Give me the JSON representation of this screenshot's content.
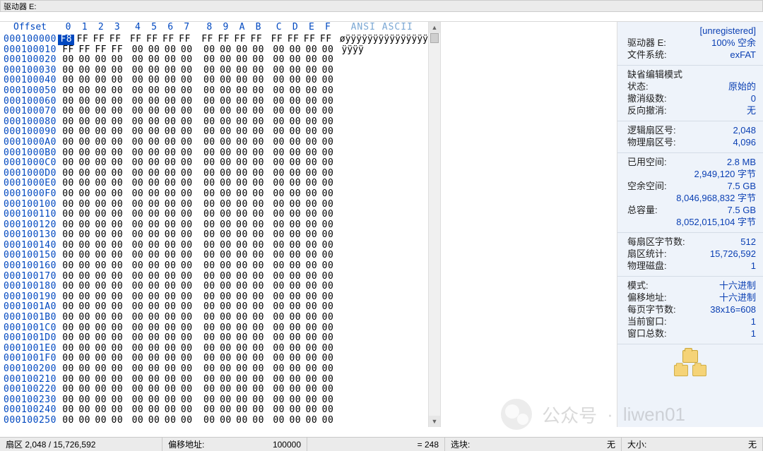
{
  "title_bar": {
    "label": "驱动器 E:"
  },
  "hex_header": {
    "offset_label": "Offset",
    "cols": [
      "0",
      "1",
      "2",
      "3",
      "4",
      "5",
      "6",
      "7",
      "8",
      "9",
      "A",
      "B",
      "C",
      "D",
      "E",
      "F"
    ],
    "ansi_label": "ANSI ASCII"
  },
  "hex_rows": [
    {
      "addr": "000100000",
      "bytes": [
        "F8",
        "FF",
        "FF",
        "FF",
        "FF",
        "FF",
        "FF",
        "FF",
        "FF",
        "FF",
        "FF",
        "FF",
        "FF",
        "FF",
        "FF",
        "FF"
      ],
      "ansi": "øÿÿÿÿÿÿÿÿÿÿÿÿÿÿÿ",
      "sel": 0
    },
    {
      "addr": "000100010",
      "bytes": [
        "FF",
        "FF",
        "FF",
        "FF",
        "00",
        "00",
        "00",
        "00",
        "00",
        "00",
        "00",
        "00",
        "00",
        "00",
        "00",
        "00"
      ],
      "ansi": "ÿÿÿÿ"
    },
    {
      "addr": "000100020",
      "bytes": [
        "00",
        "00",
        "00",
        "00",
        "00",
        "00",
        "00",
        "00",
        "00",
        "00",
        "00",
        "00",
        "00",
        "00",
        "00",
        "00"
      ],
      "ansi": ""
    },
    {
      "addr": "000100030",
      "bytes": [
        "00",
        "00",
        "00",
        "00",
        "00",
        "00",
        "00",
        "00",
        "00",
        "00",
        "00",
        "00",
        "00",
        "00",
        "00",
        "00"
      ],
      "ansi": ""
    },
    {
      "addr": "000100040",
      "bytes": [
        "00",
        "00",
        "00",
        "00",
        "00",
        "00",
        "00",
        "00",
        "00",
        "00",
        "00",
        "00",
        "00",
        "00",
        "00",
        "00"
      ],
      "ansi": ""
    },
    {
      "addr": "000100050",
      "bytes": [
        "00",
        "00",
        "00",
        "00",
        "00",
        "00",
        "00",
        "00",
        "00",
        "00",
        "00",
        "00",
        "00",
        "00",
        "00",
        "00"
      ],
      "ansi": ""
    },
    {
      "addr": "000100060",
      "bytes": [
        "00",
        "00",
        "00",
        "00",
        "00",
        "00",
        "00",
        "00",
        "00",
        "00",
        "00",
        "00",
        "00",
        "00",
        "00",
        "00"
      ],
      "ansi": ""
    },
    {
      "addr": "000100070",
      "bytes": [
        "00",
        "00",
        "00",
        "00",
        "00",
        "00",
        "00",
        "00",
        "00",
        "00",
        "00",
        "00",
        "00",
        "00",
        "00",
        "00"
      ],
      "ansi": ""
    },
    {
      "addr": "000100080",
      "bytes": [
        "00",
        "00",
        "00",
        "00",
        "00",
        "00",
        "00",
        "00",
        "00",
        "00",
        "00",
        "00",
        "00",
        "00",
        "00",
        "00"
      ],
      "ansi": ""
    },
    {
      "addr": "000100090",
      "bytes": [
        "00",
        "00",
        "00",
        "00",
        "00",
        "00",
        "00",
        "00",
        "00",
        "00",
        "00",
        "00",
        "00",
        "00",
        "00",
        "00"
      ],
      "ansi": ""
    },
    {
      "addr": "0001000A0",
      "bytes": [
        "00",
        "00",
        "00",
        "00",
        "00",
        "00",
        "00",
        "00",
        "00",
        "00",
        "00",
        "00",
        "00",
        "00",
        "00",
        "00"
      ],
      "ansi": ""
    },
    {
      "addr": "0001000B0",
      "bytes": [
        "00",
        "00",
        "00",
        "00",
        "00",
        "00",
        "00",
        "00",
        "00",
        "00",
        "00",
        "00",
        "00",
        "00",
        "00",
        "00"
      ],
      "ansi": ""
    },
    {
      "addr": "0001000C0",
      "bytes": [
        "00",
        "00",
        "00",
        "00",
        "00",
        "00",
        "00",
        "00",
        "00",
        "00",
        "00",
        "00",
        "00",
        "00",
        "00",
        "00"
      ],
      "ansi": ""
    },
    {
      "addr": "0001000D0",
      "bytes": [
        "00",
        "00",
        "00",
        "00",
        "00",
        "00",
        "00",
        "00",
        "00",
        "00",
        "00",
        "00",
        "00",
        "00",
        "00",
        "00"
      ],
      "ansi": ""
    },
    {
      "addr": "0001000E0",
      "bytes": [
        "00",
        "00",
        "00",
        "00",
        "00",
        "00",
        "00",
        "00",
        "00",
        "00",
        "00",
        "00",
        "00",
        "00",
        "00",
        "00"
      ],
      "ansi": ""
    },
    {
      "addr": "0001000F0",
      "bytes": [
        "00",
        "00",
        "00",
        "00",
        "00",
        "00",
        "00",
        "00",
        "00",
        "00",
        "00",
        "00",
        "00",
        "00",
        "00",
        "00"
      ],
      "ansi": ""
    },
    {
      "addr": "000100100",
      "bytes": [
        "00",
        "00",
        "00",
        "00",
        "00",
        "00",
        "00",
        "00",
        "00",
        "00",
        "00",
        "00",
        "00",
        "00",
        "00",
        "00"
      ],
      "ansi": ""
    },
    {
      "addr": "000100110",
      "bytes": [
        "00",
        "00",
        "00",
        "00",
        "00",
        "00",
        "00",
        "00",
        "00",
        "00",
        "00",
        "00",
        "00",
        "00",
        "00",
        "00"
      ],
      "ansi": ""
    },
    {
      "addr": "000100120",
      "bytes": [
        "00",
        "00",
        "00",
        "00",
        "00",
        "00",
        "00",
        "00",
        "00",
        "00",
        "00",
        "00",
        "00",
        "00",
        "00",
        "00"
      ],
      "ansi": ""
    },
    {
      "addr": "000100130",
      "bytes": [
        "00",
        "00",
        "00",
        "00",
        "00",
        "00",
        "00",
        "00",
        "00",
        "00",
        "00",
        "00",
        "00",
        "00",
        "00",
        "00"
      ],
      "ansi": ""
    },
    {
      "addr": "000100140",
      "bytes": [
        "00",
        "00",
        "00",
        "00",
        "00",
        "00",
        "00",
        "00",
        "00",
        "00",
        "00",
        "00",
        "00",
        "00",
        "00",
        "00"
      ],
      "ansi": ""
    },
    {
      "addr": "000100150",
      "bytes": [
        "00",
        "00",
        "00",
        "00",
        "00",
        "00",
        "00",
        "00",
        "00",
        "00",
        "00",
        "00",
        "00",
        "00",
        "00",
        "00"
      ],
      "ansi": ""
    },
    {
      "addr": "000100160",
      "bytes": [
        "00",
        "00",
        "00",
        "00",
        "00",
        "00",
        "00",
        "00",
        "00",
        "00",
        "00",
        "00",
        "00",
        "00",
        "00",
        "00"
      ],
      "ansi": ""
    },
    {
      "addr": "000100170",
      "bytes": [
        "00",
        "00",
        "00",
        "00",
        "00",
        "00",
        "00",
        "00",
        "00",
        "00",
        "00",
        "00",
        "00",
        "00",
        "00",
        "00"
      ],
      "ansi": ""
    },
    {
      "addr": "000100180",
      "bytes": [
        "00",
        "00",
        "00",
        "00",
        "00",
        "00",
        "00",
        "00",
        "00",
        "00",
        "00",
        "00",
        "00",
        "00",
        "00",
        "00"
      ],
      "ansi": ""
    },
    {
      "addr": "000100190",
      "bytes": [
        "00",
        "00",
        "00",
        "00",
        "00",
        "00",
        "00",
        "00",
        "00",
        "00",
        "00",
        "00",
        "00",
        "00",
        "00",
        "00"
      ],
      "ansi": ""
    },
    {
      "addr": "0001001A0",
      "bytes": [
        "00",
        "00",
        "00",
        "00",
        "00",
        "00",
        "00",
        "00",
        "00",
        "00",
        "00",
        "00",
        "00",
        "00",
        "00",
        "00"
      ],
      "ansi": ""
    },
    {
      "addr": "0001001B0",
      "bytes": [
        "00",
        "00",
        "00",
        "00",
        "00",
        "00",
        "00",
        "00",
        "00",
        "00",
        "00",
        "00",
        "00",
        "00",
        "00",
        "00"
      ],
      "ansi": ""
    },
    {
      "addr": "0001001C0",
      "bytes": [
        "00",
        "00",
        "00",
        "00",
        "00",
        "00",
        "00",
        "00",
        "00",
        "00",
        "00",
        "00",
        "00",
        "00",
        "00",
        "00"
      ],
      "ansi": ""
    },
    {
      "addr": "0001001D0",
      "bytes": [
        "00",
        "00",
        "00",
        "00",
        "00",
        "00",
        "00",
        "00",
        "00",
        "00",
        "00",
        "00",
        "00",
        "00",
        "00",
        "00"
      ],
      "ansi": ""
    },
    {
      "addr": "0001001E0",
      "bytes": [
        "00",
        "00",
        "00",
        "00",
        "00",
        "00",
        "00",
        "00",
        "00",
        "00",
        "00",
        "00",
        "00",
        "00",
        "00",
        "00"
      ],
      "ansi": ""
    },
    {
      "addr": "0001001F0",
      "bytes": [
        "00",
        "00",
        "00",
        "00",
        "00",
        "00",
        "00",
        "00",
        "00",
        "00",
        "00",
        "00",
        "00",
        "00",
        "00",
        "00"
      ],
      "ansi": ""
    },
    {
      "addr": "000100200",
      "bytes": [
        "00",
        "00",
        "00",
        "00",
        "00",
        "00",
        "00",
        "00",
        "00",
        "00",
        "00",
        "00",
        "00",
        "00",
        "00",
        "00"
      ],
      "ansi": ""
    },
    {
      "addr": "000100210",
      "bytes": [
        "00",
        "00",
        "00",
        "00",
        "00",
        "00",
        "00",
        "00",
        "00",
        "00",
        "00",
        "00",
        "00",
        "00",
        "00",
        "00"
      ],
      "ansi": ""
    },
    {
      "addr": "000100220",
      "bytes": [
        "00",
        "00",
        "00",
        "00",
        "00",
        "00",
        "00",
        "00",
        "00",
        "00",
        "00",
        "00",
        "00",
        "00",
        "00",
        "00"
      ],
      "ansi": ""
    },
    {
      "addr": "000100230",
      "bytes": [
        "00",
        "00",
        "00",
        "00",
        "00",
        "00",
        "00",
        "00",
        "00",
        "00",
        "00",
        "00",
        "00",
        "00",
        "00",
        "00"
      ],
      "ansi": ""
    },
    {
      "addr": "000100240",
      "bytes": [
        "00",
        "00",
        "00",
        "00",
        "00",
        "00",
        "00",
        "00",
        "00",
        "00",
        "00",
        "00",
        "00",
        "00",
        "00",
        "00"
      ],
      "ansi": ""
    },
    {
      "addr": "000100250",
      "bytes": [
        "00",
        "00",
        "00",
        "00",
        "00",
        "00",
        "00",
        "00",
        "00",
        "00",
        "00",
        "00",
        "00",
        "00",
        "00",
        "00"
      ],
      "ansi": ""
    }
  ],
  "info": {
    "unregistered": "[unregistered]",
    "drive_label": "驱动器 E:",
    "drive_free": "100% 空余",
    "fs_label": "文件系统:",
    "fs_value": "exFAT",
    "edit_mode_label": "缺省编辑模式",
    "state_label": "状态:",
    "state_value": "原始的",
    "undo_label": "撤消级数:",
    "undo_value": "0",
    "redo_label": "反向撤消:",
    "redo_value": "无",
    "logical_sector_label": "逻辑扇区号:",
    "logical_sector_value": "2,048",
    "physical_sector_label": "物理扇区号:",
    "physical_sector_value": "4,096",
    "used_label": "已用空间:",
    "used_value": "2.8 MB",
    "used_bytes": "2,949,120 字节",
    "free_label": "空余空间:",
    "free_value": "7.5 GB",
    "free_bytes": "8,046,968,832 字节",
    "total_label": "总容量:",
    "total_value": "7.5 GB",
    "total_bytes": "8,052,015,104 字节",
    "bps_label": "每扇区字节数:",
    "bps_value": "512",
    "sector_count_label": "扇区统计:",
    "sector_count_value": "15,726,592",
    "phys_disk_label": "物理磁盘:",
    "phys_disk_value": "1",
    "mode_label": "模式:",
    "mode_value": "十六进制",
    "offset_mode_label": "偏移地址:",
    "offset_mode_value": "十六进制",
    "page_bytes_label": "每页字节数:",
    "page_bytes_value": "38x16=608",
    "cur_win_label": "当前窗口:",
    "cur_win_value": "1",
    "win_total_label": "窗口总数:",
    "win_total_value": "1"
  },
  "status": {
    "sector": "扇区 2,048 / 15,726,592",
    "offset_label": "偏移地址:",
    "offset_value": "100000",
    "byte_value": "= 248",
    "selection_label": "选块:",
    "selection_value": "无",
    "size_label": "大小:",
    "size_value": "无"
  },
  "watermark": {
    "a": "公众号",
    "dot": "·",
    "b": "liwen01"
  }
}
